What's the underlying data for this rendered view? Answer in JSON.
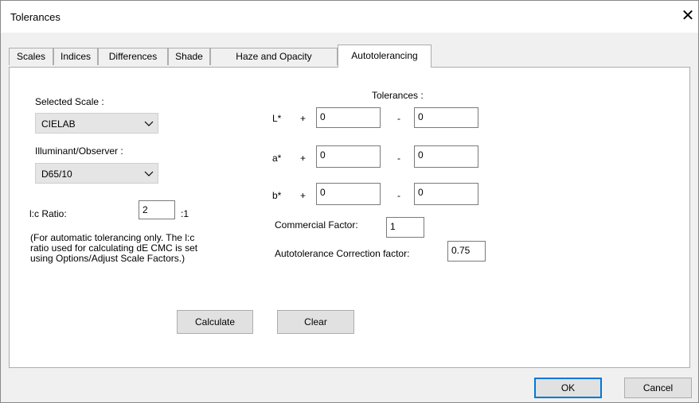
{
  "window": {
    "title": "Tolerances",
    "close_glyph": "✕"
  },
  "tabs": [
    {
      "label": "Scales",
      "active": false
    },
    {
      "label": "Indices",
      "active": false
    },
    {
      "label": "Differences",
      "active": false
    },
    {
      "label": "Shade",
      "active": false
    },
    {
      "label": "Haze and Opacity",
      "active": false
    },
    {
      "label": "Autotolerancing",
      "active": true
    }
  ],
  "left": {
    "selected_scale_label": "Selected Scale :",
    "selected_scale_value": "CIELAB",
    "illuminant_label": "Illuminant/Observer :",
    "illuminant_value": "D65/10",
    "lc_ratio_label": "l:c Ratio:",
    "lc_ratio_value": "2",
    "lc_ratio_suffix": ":1",
    "note_lines": [
      "(For automatic tolerancing only.  The l:c",
      "ratio used for calculating dE CMC is set",
      "using Options/Adjust Scale Factors.)"
    ]
  },
  "tolerances": {
    "header": "Tolerances :",
    "plus": "+",
    "minus": "-",
    "rows": [
      {
        "label": "L*",
        "plus_value": "0",
        "minus_value": "0"
      },
      {
        "label": "a*",
        "plus_value": "0",
        "minus_value": "0"
      },
      {
        "label": "b*",
        "plus_value": "0",
        "minus_value": "0"
      }
    ],
    "commercial_factor_label": "Commercial Factor:",
    "commercial_factor_value": "1",
    "autotolerance_label": "Autotolerance Correction factor:",
    "autotolerance_value": "0.75"
  },
  "actions": {
    "calculate": "Calculate",
    "clear": "Clear"
  },
  "footer": {
    "ok": "OK",
    "cancel": "Cancel"
  },
  "colors": {
    "accent": "#0078d7",
    "panel": "#ffffff",
    "window": "#f0f0f0"
  }
}
